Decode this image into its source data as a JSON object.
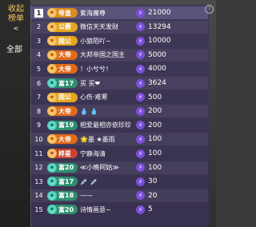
{
  "sidebar": {
    "tab_line1": "收起",
    "tab_line2": "榜单",
    "arrow": "<",
    "all": "全部"
  },
  "help": "?",
  "rows": [
    {
      "rank": "1",
      "badge": "帝皇",
      "badge_type": "emperor",
      "name": "紫海魔尊",
      "points": "21000",
      "top": true
    },
    {
      "rank": "2",
      "badge": "公爵",
      "badge_type": "duke",
      "name": "微信天天发财",
      "points": "13294"
    },
    {
      "rank": "3",
      "badge": "国公",
      "badge_type": "duke",
      "name": "小狼陌吖~",
      "points": "10000"
    },
    {
      "rank": "4",
      "badge": "大帝",
      "badge_type": "lord",
      "name": "大邦帝国之国主",
      "points": "5000"
    },
    {
      "rank": "5",
      "badge": "大帝",
      "badge_type": "lord",
      "name": "！小兮兮！",
      "points": "4000"
    },
    {
      "rank": "6",
      "badge": "富17",
      "badge_type": "rich",
      "name": "买 买❤",
      "points": "3624"
    },
    {
      "rank": "7",
      "badge": "国公",
      "badge_type": "duke",
      "name": "心伤·难寒",
      "points": "500"
    },
    {
      "rank": "8",
      "badge": "大帝",
      "badge_type": "lord",
      "name": "💧 💧",
      "points": "200"
    },
    {
      "rank": "9",
      "badge": "富19",
      "badge_type": "rich",
      "name": "相爱最相亦依珍珍",
      "points": "200"
    },
    {
      "rank": "10",
      "badge": "大帝",
      "badge_type": "lord",
      "name": "🌟墨 ★墨雨",
      "points": "100"
    },
    {
      "rank": "11",
      "badge": "梓星",
      "badge_type": "bang",
      "name": "宁静海清",
      "points": "100"
    },
    {
      "rank": "12",
      "badge": "富20",
      "badge_type": "rich",
      "name": "≪小晚阿姑≫",
      "points": "100"
    },
    {
      "rank": "13",
      "badge": "富17",
      "badge_type": "rich",
      "name": "💉 💉",
      "points": "30"
    },
    {
      "rank": "14",
      "badge": "富18",
      "badge_type": "rich",
      "name": "——",
      "points": "20"
    },
    {
      "rank": "15",
      "badge": "富20",
      "badge_type": "rich",
      "name": "诗情画意~",
      "points": "5"
    }
  ]
}
